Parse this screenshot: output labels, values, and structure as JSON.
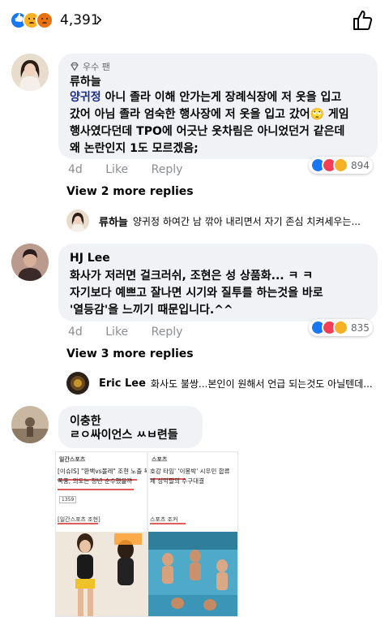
{
  "reactions_bar": {
    "total": "4,391",
    "chevron": "›"
  },
  "comments": [
    {
      "badge": "우수 팬",
      "author": "류하늘",
      "highlight": "양귀정",
      "lines": [
        " 아니 졸라 이해 안가는게 장례식장에 저 옷을 입고",
        "갔어 아님 졸라 엄숙한 행사장에 저 옷을 입고 갔어🙄 게임",
        "행사였다던데 TPO에 어긋난 옷차림은 아니었던거 같은데",
        "왜 논란인지 1도 모르겠음;"
      ],
      "time": "4d",
      "like": "Like",
      "reply": "Reply",
      "reaction_count": "894",
      "more_replies": "View 2 more replies",
      "last_reply": {
        "author": "류하늘",
        "text": "양귀정 하여간 남 깎아 내리면서 자기 존심 치켜세우는..."
      }
    },
    {
      "author": "HJ Lee",
      "lines": [
        "화사가 저러면 걸크러쉬, 조현은 성 상품화... ㅋ ㅋ",
        "자기보다 예쁘고 잘나면 시기와 질투를 하는것을 바로",
        "'열등감'을 느끼기 때문입니다.^^"
      ],
      "time": "4d",
      "like": "Like",
      "reply": "Reply",
      "reaction_count": "835",
      "more_replies": "View 3 more replies",
      "last_reply": {
        "author": "Eric Lee",
        "text": "화사도 불쌍...본인이 원해서 언급 되는것도 아닐텐데..."
      }
    },
    {
      "author": "이충한",
      "lines": [
        "ㄹㅇ싸이언스 ㅆㅂ련들"
      ]
    }
  ],
  "photo": {
    "left_tag": "[이슈IS] \"환백vs볼레\" 조현 노출 복",
    "left_tag2": "폭풍, 의도는 청년 순수했을까",
    "right_tag": "호강 타임' '이봉박' 시우민 합류",
    "right_tag2": "체 싱익팔의 수구대결",
    "left_source": "[일간스포츠 조현]",
    "right_source": "스포츠 조커",
    "left_brand": "일간스포츠",
    "right_brand": "스포츠",
    "left_count": "1359"
  }
}
